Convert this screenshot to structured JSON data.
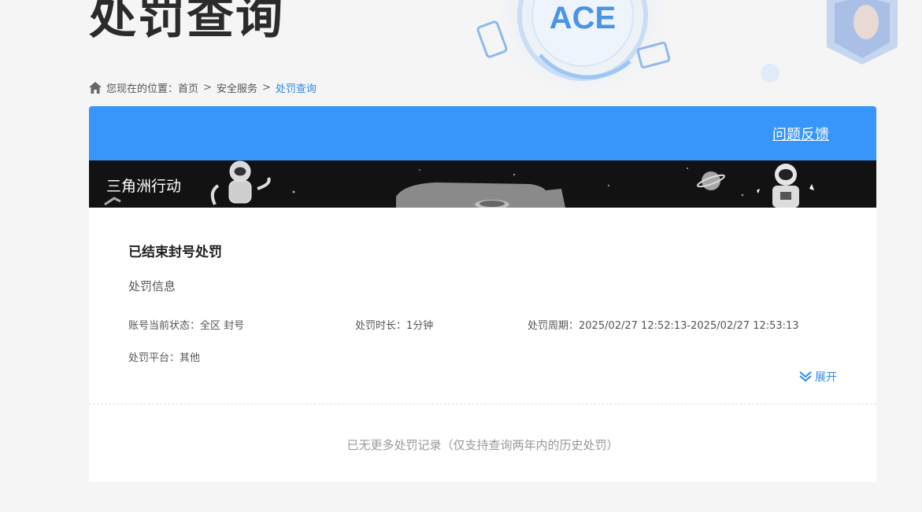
{
  "page": {
    "title": "处罚查询"
  },
  "breadcrumb": {
    "prefix": "您现在的位置：",
    "items": [
      "首页",
      "安全服务",
      "处罚查询"
    ],
    "separator": ">"
  },
  "header": {
    "feedback_label": "问题反馈"
  },
  "game": {
    "name": "三角洲行动"
  },
  "record": {
    "title": "已结束封号处罚",
    "section_label": "处罚信息",
    "status": "账号当前状态：全区 封号",
    "duration": "处罚时长：1分钟",
    "period": "处罚周期：2025/02/27 12:52:13-2025/02/27 12:53:13",
    "platform": "处罚平台：其他",
    "expand_label": "展开"
  },
  "footer": {
    "no_more_text": "已无更多处罚记录（仅支持查询两年内的历史处罚）"
  },
  "colors": {
    "accent": "#3896fb",
    "link": "#2f8ae8",
    "banner_bg": "#121212",
    "page_bg": "#f5f5f5"
  },
  "icons": {
    "home": "home-icon",
    "expand": "double-chevron-down-icon",
    "logo": "ace-logo-icon"
  }
}
